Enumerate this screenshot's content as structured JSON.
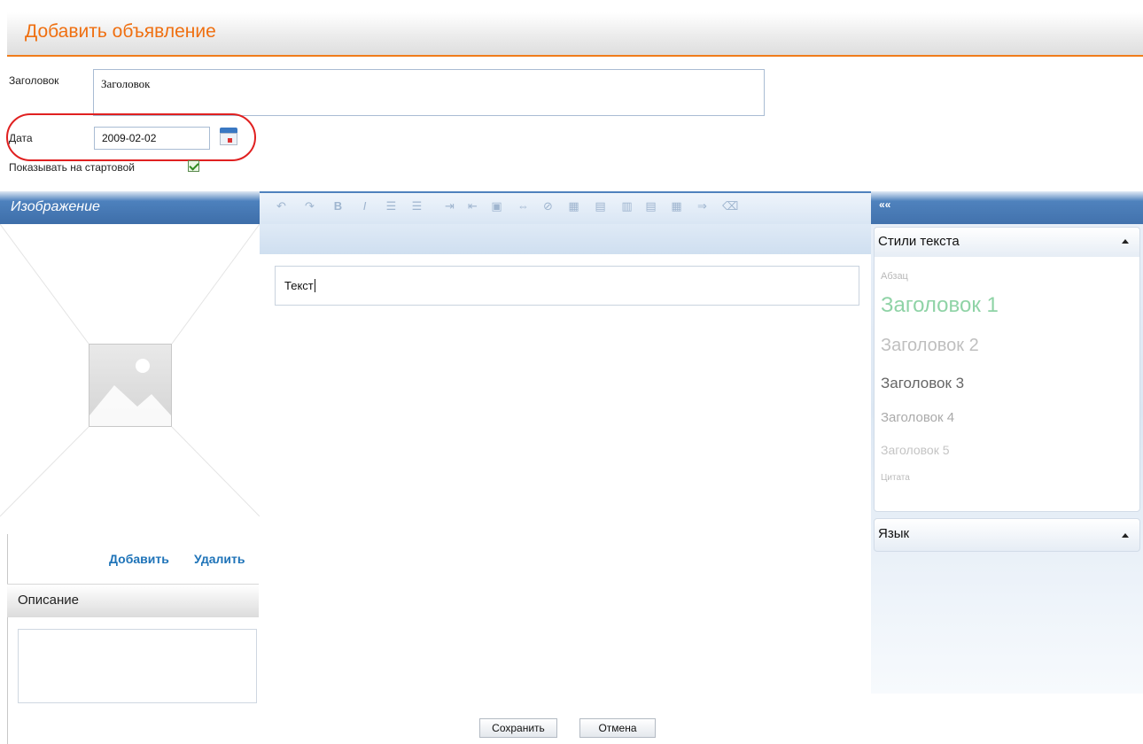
{
  "header": {
    "title": "Добавить объявление"
  },
  "form": {
    "title_label": "Заголовок",
    "title_value": "Заголовок",
    "date_label": "Дата",
    "date_value": "2009-02-02",
    "show_on_start_label": "Показывать на стартовой",
    "show_on_start_checked": true
  },
  "image_panel": {
    "title": "Изображение",
    "add_link": "Добавить",
    "delete_link": "Удалить"
  },
  "description_panel": {
    "title": "Описание"
  },
  "editor": {
    "toolbar_icons": [
      "undo-icon",
      "redo-icon",
      "bold-icon",
      "italic-icon",
      "numbered-list-icon",
      "bullet-list-icon",
      "indent-icon",
      "outdent-icon",
      "image-icon",
      "link-icon",
      "unlink-icon",
      "table-icon",
      "insert-row-icon",
      "insert-column-icon",
      "delete-row-icon",
      "merge-cells-icon",
      "split-icon",
      "clear-format-icon"
    ],
    "content": "Текст"
  },
  "right_panel": {
    "collapse_label": "««",
    "styles_title": "Стили текста",
    "styles": [
      {
        "name": "Абзац",
        "color": "#b8b8b8"
      },
      {
        "name": "Заголовок 1",
        "color": "#8fd3a6"
      },
      {
        "name": "Заголовок 2",
        "color": "#bfbfbf"
      },
      {
        "name": "Заголовок 3",
        "color": "#666666"
      },
      {
        "name": "Заголовок 4",
        "color": "#aaaaaa"
      },
      {
        "name": "Заголовок 5",
        "color": "#c4c4c4"
      },
      {
        "name": "Цитата",
        "color": "#bbbbbb"
      }
    ],
    "language_title": "Язык"
  },
  "buttons": {
    "save": "Сохранить",
    "cancel": "Отмена"
  },
  "colors": {
    "accent": "#ef6f10",
    "link": "#1e73b8",
    "panel_blue": "#4f82bd",
    "highlight": "#e02020"
  }
}
